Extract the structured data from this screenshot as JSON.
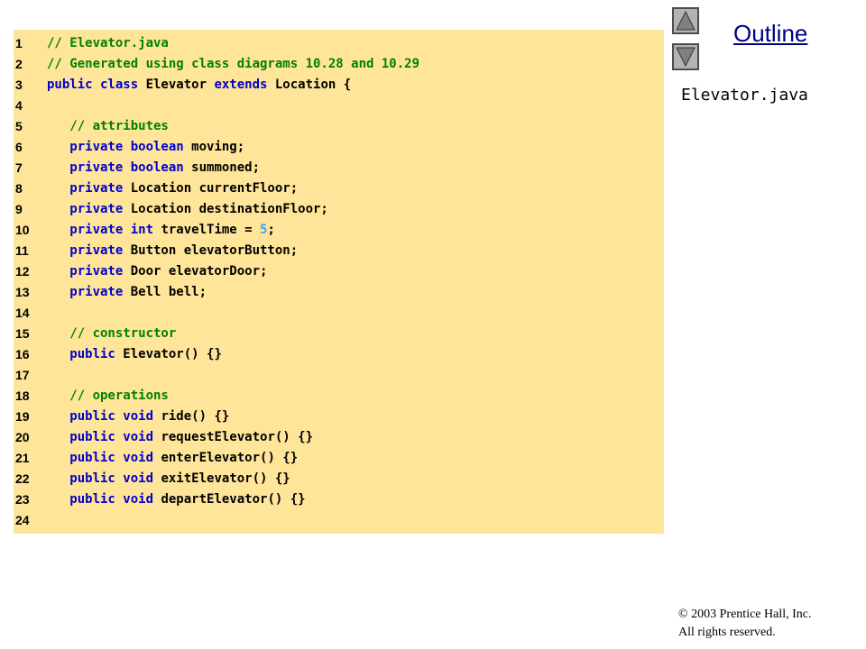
{
  "navigation": {
    "outline_label": "Outline",
    "up_icon": "triangle-up-icon",
    "down_icon": "triangle-down-icon"
  },
  "file_label": "Elevator.java",
  "copyright": {
    "line1": "© 2003 Prentice Hall, Inc.",
    "line2": "All rights reserved."
  },
  "colors": {
    "panel_background": "#ffe599",
    "comment": "#008000",
    "keyword": "#0000cc",
    "literal": "#33aaff",
    "outline_link": "#000080"
  },
  "code": {
    "lines": [
      {
        "num": "1",
        "tokens": [
          {
            "t": "// Elevator.java",
            "k": "comment"
          }
        ]
      },
      {
        "num": "2",
        "tokens": [
          {
            "t": "// Generated using class diagrams 10.28 and 10.29",
            "k": "comment"
          }
        ]
      },
      {
        "num": "3",
        "tokens": [
          {
            "t": "public class ",
            "k": "keyword"
          },
          {
            "t": "Elevator ",
            "k": "plain"
          },
          {
            "t": "extends ",
            "k": "keyword"
          },
          {
            "t": "Location {",
            "k": "plain"
          }
        ]
      },
      {
        "num": "4",
        "tokens": []
      },
      {
        "num": "5",
        "tokens": [
          {
            "t": "   // attributes",
            "k": "comment"
          }
        ]
      },
      {
        "num": "6",
        "tokens": [
          {
            "t": "   private boolean ",
            "k": "keyword"
          },
          {
            "t": "moving;",
            "k": "plain"
          }
        ]
      },
      {
        "num": "7",
        "tokens": [
          {
            "t": "   private boolean ",
            "k": "keyword"
          },
          {
            "t": "summoned;",
            "k": "plain"
          }
        ]
      },
      {
        "num": "8",
        "tokens": [
          {
            "t": "   private ",
            "k": "keyword"
          },
          {
            "t": "Location currentFloor;",
            "k": "plain"
          }
        ]
      },
      {
        "num": "9",
        "tokens": [
          {
            "t": "   private ",
            "k": "keyword"
          },
          {
            "t": "Location destinationFloor;",
            "k": "plain"
          }
        ]
      },
      {
        "num": "10",
        "tokens": [
          {
            "t": "   private int ",
            "k": "keyword"
          },
          {
            "t": "travelTime = ",
            "k": "plain"
          },
          {
            "t": "5",
            "k": "literal"
          },
          {
            "t": ";",
            "k": "plain"
          }
        ]
      },
      {
        "num": "11",
        "tokens": [
          {
            "t": "   private ",
            "k": "keyword"
          },
          {
            "t": "Button elevatorButton;",
            "k": "plain"
          }
        ]
      },
      {
        "num": "12",
        "tokens": [
          {
            "t": "   private ",
            "k": "keyword"
          },
          {
            "t": "Door elevatorDoor;",
            "k": "plain"
          }
        ]
      },
      {
        "num": "13",
        "tokens": [
          {
            "t": "   private ",
            "k": "keyword"
          },
          {
            "t": "Bell bell;",
            "k": "plain"
          }
        ]
      },
      {
        "num": "14",
        "tokens": []
      },
      {
        "num": "15",
        "tokens": [
          {
            "t": "   // constructor",
            "k": "comment"
          }
        ]
      },
      {
        "num": "16",
        "tokens": [
          {
            "t": "   public ",
            "k": "keyword"
          },
          {
            "t": "Elevator() {}",
            "k": "plain"
          }
        ]
      },
      {
        "num": "17",
        "tokens": []
      },
      {
        "num": "18",
        "tokens": [
          {
            "t": "   // operations",
            "k": "comment"
          }
        ]
      },
      {
        "num": "19",
        "tokens": [
          {
            "t": "   public void ",
            "k": "keyword"
          },
          {
            "t": "ride() {}",
            "k": "plain"
          }
        ]
      },
      {
        "num": "20",
        "tokens": [
          {
            "t": "   public void ",
            "k": "keyword"
          },
          {
            "t": "requestElevator() {}",
            "k": "plain"
          }
        ]
      },
      {
        "num": "21",
        "tokens": [
          {
            "t": "   public void ",
            "k": "keyword"
          },
          {
            "t": "enterElevator() {}",
            "k": "plain"
          }
        ]
      },
      {
        "num": "22",
        "tokens": [
          {
            "t": "   public void ",
            "k": "keyword"
          },
          {
            "t": "exitElevator() {}",
            "k": "plain"
          }
        ]
      },
      {
        "num": "23",
        "tokens": [
          {
            "t": "   public void ",
            "k": "keyword"
          },
          {
            "t": "departElevator() {}",
            "k": "plain"
          }
        ]
      },
      {
        "num": "24",
        "tokens": []
      }
    ]
  }
}
